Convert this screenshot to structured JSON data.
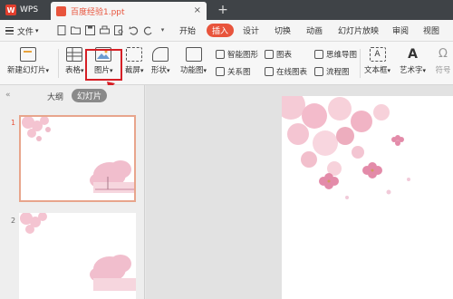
{
  "titlebar": {
    "app_name": "WPS",
    "app_logo": "W",
    "doc_title": "百度经验1.ppt",
    "close_icon": "×",
    "new_tab_icon": "+"
  },
  "menubar": {
    "file_label": "文件",
    "file_arrow": "▾",
    "tabs": [
      "开始",
      "插入",
      "设计",
      "切换",
      "动画",
      "幻灯片放映",
      "审阅",
      "视图"
    ],
    "active_tab": "插入"
  },
  "ribbon": {
    "new_slide": "新建幻灯片",
    "table": "表格",
    "picture": "图片",
    "screenshot": "截屏",
    "shape": "形状",
    "function_chart": "功能图",
    "smart_graphic": "智能图形",
    "chart": "图表",
    "mind_map": "思维导图",
    "relation_chart": "关系图",
    "online_chart": "在线图表",
    "flow_chart": "流程图",
    "text_box": "文本框",
    "word_art": "艺术字",
    "symbol": "符号",
    "dropdown_arrow": "▾"
  },
  "leftpane": {
    "collapse_icon": "«",
    "tab_outline": "大纲",
    "tab_slides": "幻灯片",
    "slide_numbers": [
      "1",
      "2"
    ]
  },
  "colors": {
    "accent": "#e8543c",
    "highlight_box": "#d61f26",
    "title_bar": "#3f4347"
  }
}
